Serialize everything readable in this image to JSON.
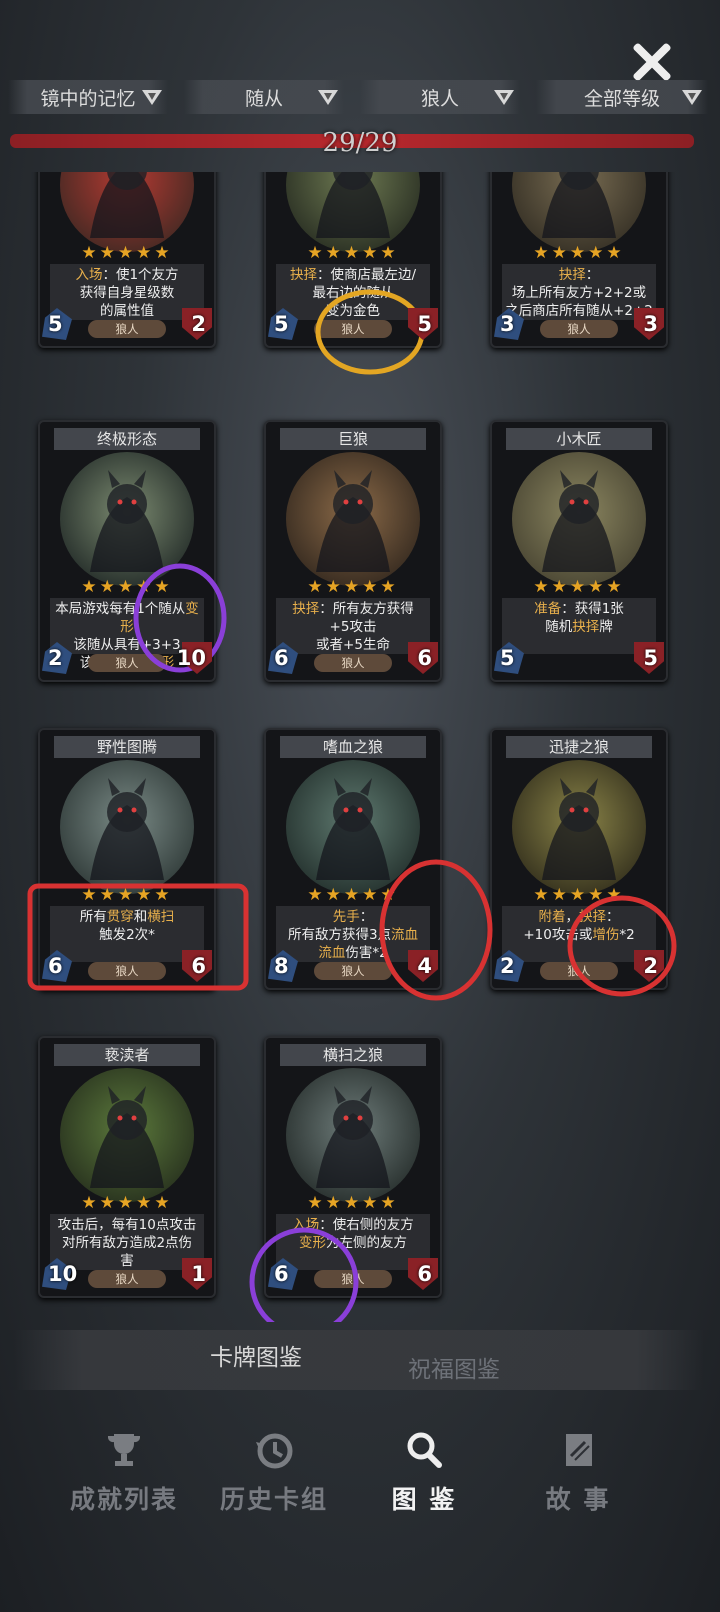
{
  "filters": [
    {
      "label": "镜中的记忆"
    },
    {
      "label": "随从"
    },
    {
      "label": "狼人"
    },
    {
      "label": "全部等级"
    }
  ],
  "progress": {
    "text": "29/29",
    "fraction": 1.0
  },
  "cards": [
    {
      "name": "",
      "desc_html": "<span class='hl-gold'>入场</span>：使1个友方<br>获得自身星级数<br>的属性值",
      "tribe": "狼人",
      "atk": "5",
      "hp": "2",
      "stars": "★★★★★"
    },
    {
      "name": "",
      "desc_html": "<span class='hl-gold'>抉择</span>：使商店最左边/<br>最右边的随从<br>变为金色",
      "tribe": "狼人",
      "atk": "5",
      "hp": "5",
      "stars": "★★★★★"
    },
    {
      "name": "",
      "desc_html": "<span class='hl-gold'>抉择</span>：<br>场上所有友方+2+2或<br>之后商店所有随从+2+2",
      "tribe": "狼人",
      "atk": "3",
      "hp": "3",
      "stars": "★★★★★"
    },
    {
      "name": "终极形态",
      "desc_html": "本局游戏每有1个随从<span class='hl-gold'>变形</span><br>该随从具有+3+3<br>该随从不会<span class='hl-gold'>变形</span>",
      "tribe": "狼人",
      "atk": "2",
      "hp": "10",
      "stars": "★★★★★"
    },
    {
      "name": "巨狼",
      "desc_html": "<span class='hl-gold'>抉择</span>：所有友方获得<br>+5攻击<br>或者+5生命",
      "tribe": "狼人",
      "atk": "6",
      "hp": "6",
      "stars": "★★★★★"
    },
    {
      "name": "小木匠",
      "desc_html": "<span class='hl-gold'>准备</span>：获得1张<br>随机<span class='hl-gold'>抉择</span>牌",
      "tribe": "",
      "atk": "5",
      "hp": "5",
      "stars": "★★★★★"
    },
    {
      "name": "野性图腾",
      "desc_html": "所有<span class='hl-gold'>贯穿</span>和<span class='hl-gold'>横扫</span><br>触发2次*",
      "tribe": "狼人",
      "atk": "6",
      "hp": "6",
      "stars": "★★★★★"
    },
    {
      "name": "嗜血之狼",
      "desc_html": "<span class='hl-gold'>先手</span>：<br>所有敌方获得3点<span class='hl-gold'>流血</span><br><span class='hl-gold'>流血</span>伤害*2",
      "tribe": "狼人",
      "atk": "8",
      "hp": "4",
      "stars": "★★★★★"
    },
    {
      "name": "迅捷之狼",
      "desc_html": "<span class='hl-gold'>附着</span>，<span class='hl-gold'>抉择</span>：<br>+10攻击或<span class='hl-gold'>增伤</span>*2",
      "tribe": "狼人",
      "atk": "2",
      "hp": "2",
      "stars": "★★★★★"
    },
    {
      "name": "亵渎者",
      "desc_html": "攻击后，每有10点攻击<br>对所有敌方造成2点伤<br>害",
      "tribe": "狼人",
      "atk": "10",
      "hp": "1",
      "stars": "★★★★★"
    },
    {
      "name": "横扫之狼",
      "desc_html": "<span class='hl-gold'>入场</span>：使右侧的友方<br><span class='hl-gold'>变形</span>为左侧的友方",
      "tribe": "狼人",
      "atk": "6",
      "hp": "6",
      "stars": "★★★★★"
    }
  ],
  "subtabs": [
    {
      "label": "卡牌图鉴",
      "active": true
    },
    {
      "label": "祝福图鉴",
      "active": false
    }
  ],
  "nav": [
    {
      "label": "成就列表",
      "icon": "trophy-icon",
      "active": false
    },
    {
      "label": "历史卡组",
      "icon": "history-icon",
      "active": false
    },
    {
      "label": "图 鉴",
      "icon": "magnifier-icon",
      "active": true
    },
    {
      "label": "故 事",
      "icon": "book-icon",
      "active": false
    }
  ],
  "colors": {
    "progress": "#b8282d",
    "star": "#e6a424",
    "keyword": "#e8b04c"
  }
}
